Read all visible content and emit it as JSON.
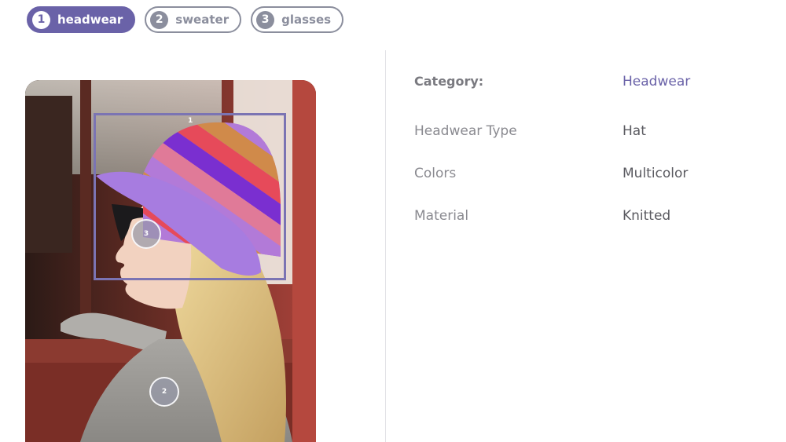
{
  "tabs": [
    {
      "number": "1",
      "label": "headwear",
      "active": true
    },
    {
      "number": "2",
      "label": "sweater",
      "active": false
    },
    {
      "number": "3",
      "label": "glasses",
      "active": false
    }
  ],
  "photo": {
    "markers": {
      "box": "1",
      "sweater": "2",
      "glasses": "3"
    }
  },
  "details": {
    "category": {
      "key": "Category:",
      "value": "Headwear"
    },
    "attributes": [
      {
        "key": "Headwear Type",
        "value": "Hat"
      },
      {
        "key": "Colors",
        "value": "Multicolor"
      },
      {
        "key": "Material",
        "value": "Knitted"
      }
    ]
  },
  "colors": {
    "accent": "#6a62a8",
    "inactive": "#8b8e9d",
    "bbox": "#7b74b3"
  }
}
